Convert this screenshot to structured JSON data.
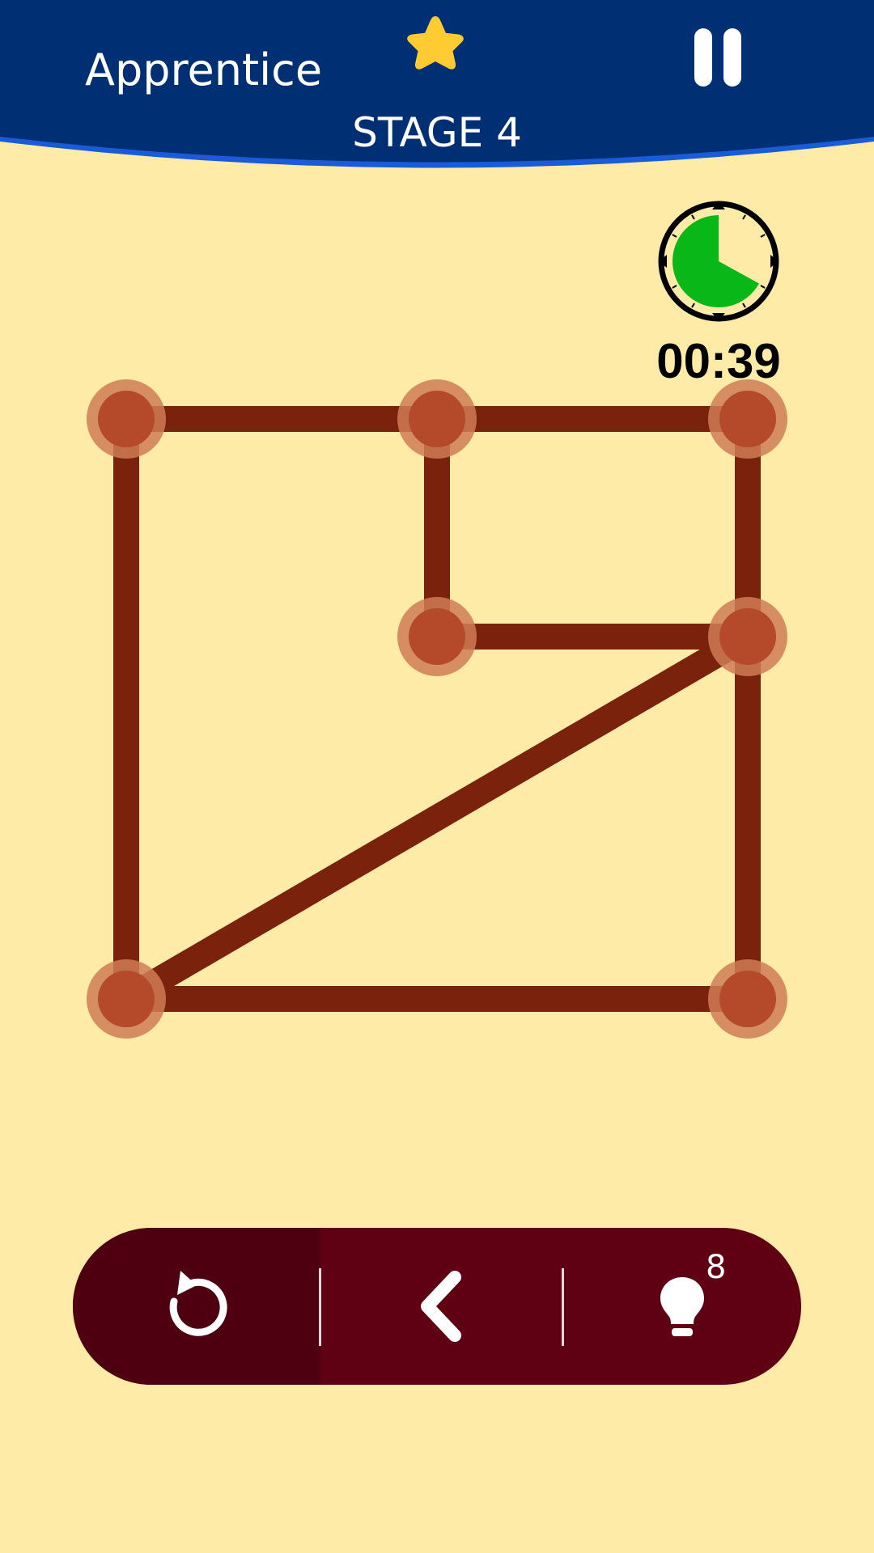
{
  "header": {
    "level_title": "Apprentice",
    "stage_label": "STAGE 4",
    "star_icon": "star-icon",
    "pause_icon": "pause-icon",
    "colors": {
      "banner": "#003073",
      "banner_edge": "#1A5BD8",
      "star": "#FECB32"
    }
  },
  "timer": {
    "display": "00:39",
    "remaining_fraction": 0.67,
    "colors": {
      "fill": "#09B818",
      "ring": "#000000"
    }
  },
  "puzzle": {
    "background": "#FEEBA8",
    "line_color": "#7A220C",
    "node_color": "#B44A2A",
    "node_halo": "#CF7C55",
    "nodes": [
      {
        "id": "A",
        "col": 0,
        "row": 0
      },
      {
        "id": "B",
        "col": 1,
        "row": 0
      },
      {
        "id": "C",
        "col": 2,
        "row": 0
      },
      {
        "id": "D",
        "col": 1,
        "row": 1
      },
      {
        "id": "E",
        "col": 2,
        "row": 1
      },
      {
        "id": "F",
        "col": 0,
        "row": 2
      },
      {
        "id": "G",
        "col": 2,
        "row": 2
      }
    ],
    "edges": [
      [
        "A",
        "B"
      ],
      [
        "B",
        "C"
      ],
      [
        "A",
        "F"
      ],
      [
        "B",
        "D"
      ],
      [
        "D",
        "E"
      ],
      [
        "C",
        "E"
      ],
      [
        "E",
        "G"
      ],
      [
        "E",
        "F"
      ],
      [
        "F",
        "G"
      ]
    ]
  },
  "toolbar": {
    "undo_icon": "undo-icon",
    "back_icon": "chevron-left-icon",
    "hint_icon": "lightbulb-icon",
    "hint_count": "8",
    "colors": {
      "bar": "#5F0013",
      "undo_segment": "#4F0010"
    }
  }
}
